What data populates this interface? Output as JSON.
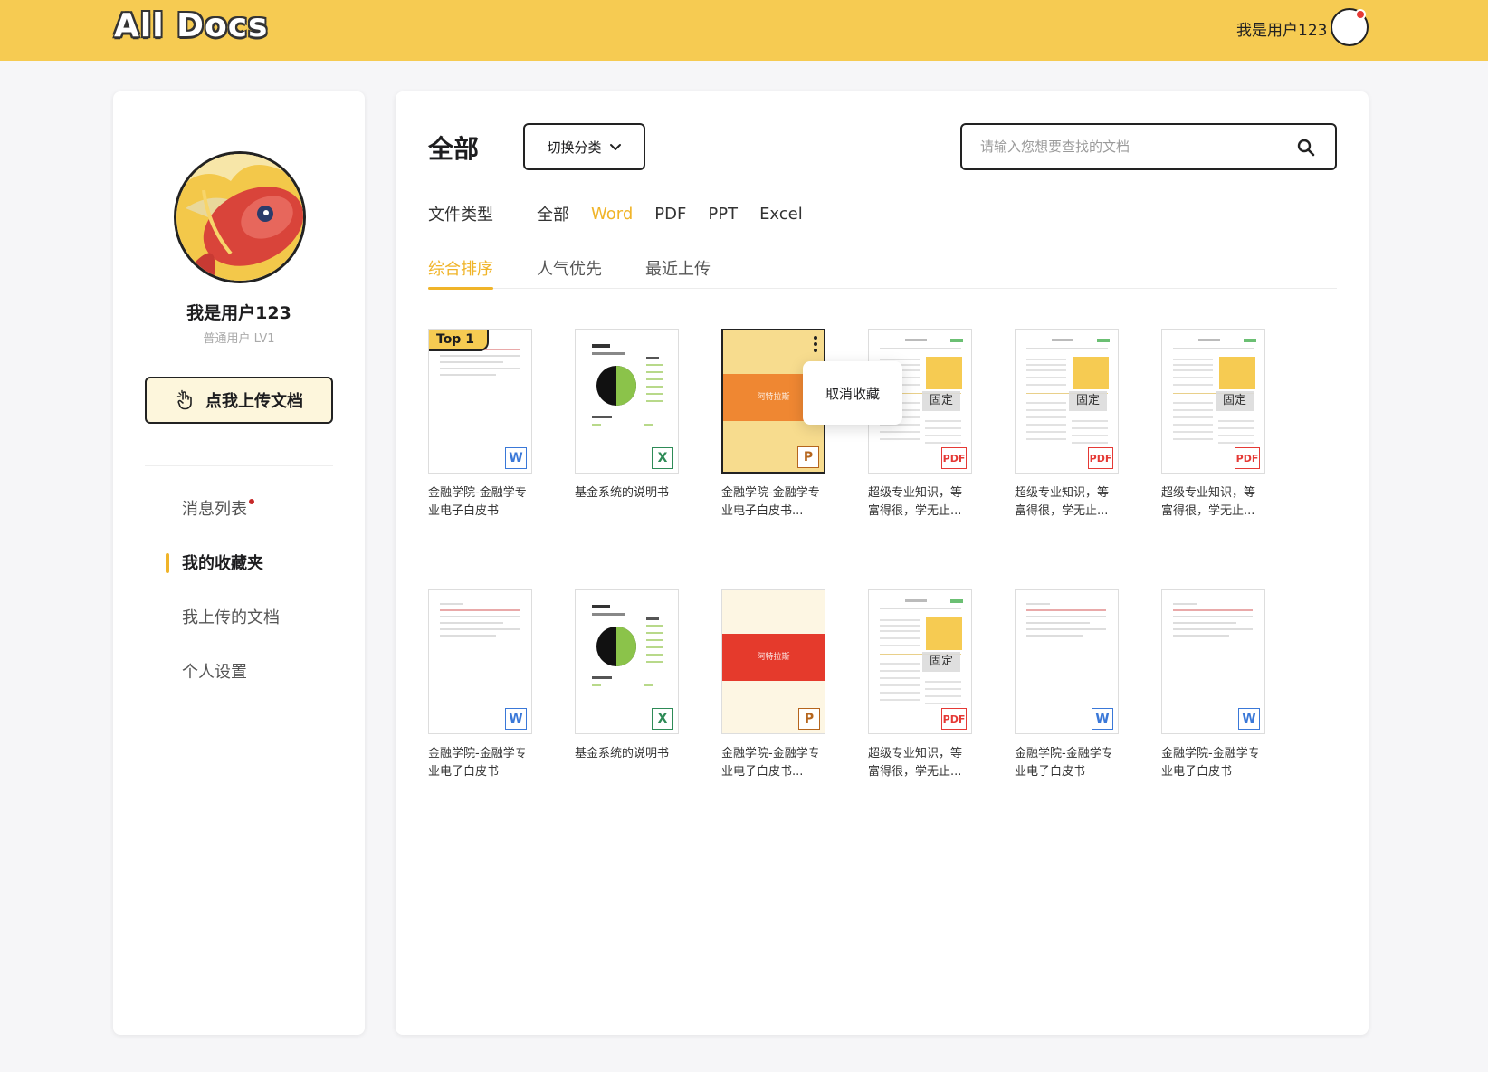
{
  "app": {
    "logo": "All Docs",
    "username": "我是用户123"
  },
  "profile": {
    "name": "我是用户123",
    "level": "普通用户 LV1",
    "upload_label": "点我上传文档"
  },
  "sidebar": {
    "items": [
      {
        "label": "消息列表",
        "has_dot": true,
        "active": false
      },
      {
        "label": "我的收藏夹",
        "active": true
      },
      {
        "label": "我上传的文档",
        "active": false
      },
      {
        "label": "个人设置",
        "active": false
      }
    ]
  },
  "main": {
    "title": "全部",
    "switch_label": "切换分类",
    "search_placeholder": "请输入您想要查找的文档",
    "filter_label": "文件类型",
    "filters": [
      "全部",
      "Word",
      "PDF",
      "PPT",
      "Excel"
    ],
    "active_filter": "Word",
    "sorts": [
      "综合排序",
      "人气优先",
      "最近上传"
    ],
    "active_sort": "综合排序",
    "popover_label": "取消收藏",
    "top_tag": "Top 1",
    "fixed_tag": "固定"
  },
  "colors": {
    "brand": "#f6cb52",
    "accent": "#f0b429",
    "pdf": "#e53935",
    "word": "#3a78d8",
    "excel": "#2e8b57"
  },
  "cards": [
    {
      "title": "金融学院-金融学专业电子白皮书",
      "type": "W",
      "style": "doc",
      "top": true
    },
    {
      "title": "基金系统的说明书",
      "type": "X",
      "style": "chart"
    },
    {
      "title": "金融学院-金融学专业电子白皮书...",
      "type": "P",
      "style": "orange",
      "selected": true,
      "band": "阿特拉斯"
    },
    {
      "title": "超级专业知识，等富得很，学无止...",
      "type": "PDF",
      "style": "resume",
      "fixed": true
    },
    {
      "title": "超级专业知识，等富得很，学无止...",
      "type": "PDF",
      "style": "resume",
      "fixed": true
    },
    {
      "title": "超级专业知识，等富得很，学无止...",
      "type": "PDF",
      "style": "resume",
      "fixed": true
    },
    {
      "title": "金融学院-金融学专业电子白皮书",
      "type": "W",
      "style": "doc"
    },
    {
      "title": "基金系统的说明书",
      "type": "X",
      "style": "chart"
    },
    {
      "title": "金融学院-金融学专业电子白皮书...",
      "type": "P",
      "style": "red",
      "band": "阿特拉斯"
    },
    {
      "title": "超级专业知识，等富得很，学无止...",
      "type": "PDF",
      "style": "resume",
      "fixed": true
    },
    {
      "title": "金融学院-金融学专业电子白皮书",
      "type": "W",
      "style": "doc"
    },
    {
      "title": "金融学院-金融学专业电子白皮书",
      "type": "W",
      "style": "doc"
    }
  ]
}
